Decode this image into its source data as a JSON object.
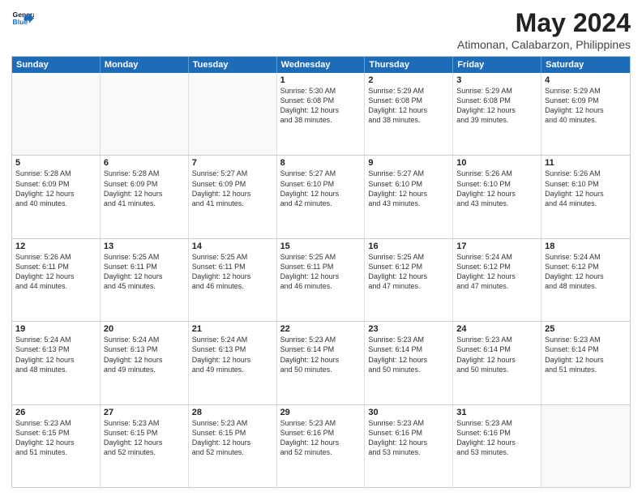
{
  "logo": {
    "line1": "General",
    "line2": "Blue"
  },
  "title": "May 2024",
  "subtitle": "Atimonan, Calabarzon, Philippines",
  "header_days": [
    "Sunday",
    "Monday",
    "Tuesday",
    "Wednesday",
    "Thursday",
    "Friday",
    "Saturday"
  ],
  "weeks": [
    [
      {
        "day": "",
        "info": ""
      },
      {
        "day": "",
        "info": ""
      },
      {
        "day": "",
        "info": ""
      },
      {
        "day": "1",
        "info": "Sunrise: 5:30 AM\nSunset: 6:08 PM\nDaylight: 12 hours\nand 38 minutes."
      },
      {
        "day": "2",
        "info": "Sunrise: 5:29 AM\nSunset: 6:08 PM\nDaylight: 12 hours\nand 38 minutes."
      },
      {
        "day": "3",
        "info": "Sunrise: 5:29 AM\nSunset: 6:08 PM\nDaylight: 12 hours\nand 39 minutes."
      },
      {
        "day": "4",
        "info": "Sunrise: 5:29 AM\nSunset: 6:09 PM\nDaylight: 12 hours\nand 40 minutes."
      }
    ],
    [
      {
        "day": "5",
        "info": "Sunrise: 5:28 AM\nSunset: 6:09 PM\nDaylight: 12 hours\nand 40 minutes."
      },
      {
        "day": "6",
        "info": "Sunrise: 5:28 AM\nSunset: 6:09 PM\nDaylight: 12 hours\nand 41 minutes."
      },
      {
        "day": "7",
        "info": "Sunrise: 5:27 AM\nSunset: 6:09 PM\nDaylight: 12 hours\nand 41 minutes."
      },
      {
        "day": "8",
        "info": "Sunrise: 5:27 AM\nSunset: 6:10 PM\nDaylight: 12 hours\nand 42 minutes."
      },
      {
        "day": "9",
        "info": "Sunrise: 5:27 AM\nSunset: 6:10 PM\nDaylight: 12 hours\nand 43 minutes."
      },
      {
        "day": "10",
        "info": "Sunrise: 5:26 AM\nSunset: 6:10 PM\nDaylight: 12 hours\nand 43 minutes."
      },
      {
        "day": "11",
        "info": "Sunrise: 5:26 AM\nSunset: 6:10 PM\nDaylight: 12 hours\nand 44 minutes."
      }
    ],
    [
      {
        "day": "12",
        "info": "Sunrise: 5:26 AM\nSunset: 6:11 PM\nDaylight: 12 hours\nand 44 minutes."
      },
      {
        "day": "13",
        "info": "Sunrise: 5:25 AM\nSunset: 6:11 PM\nDaylight: 12 hours\nand 45 minutes."
      },
      {
        "day": "14",
        "info": "Sunrise: 5:25 AM\nSunset: 6:11 PM\nDaylight: 12 hours\nand 46 minutes."
      },
      {
        "day": "15",
        "info": "Sunrise: 5:25 AM\nSunset: 6:11 PM\nDaylight: 12 hours\nand 46 minutes."
      },
      {
        "day": "16",
        "info": "Sunrise: 5:25 AM\nSunset: 6:12 PM\nDaylight: 12 hours\nand 47 minutes."
      },
      {
        "day": "17",
        "info": "Sunrise: 5:24 AM\nSunset: 6:12 PM\nDaylight: 12 hours\nand 47 minutes."
      },
      {
        "day": "18",
        "info": "Sunrise: 5:24 AM\nSunset: 6:12 PM\nDaylight: 12 hours\nand 48 minutes."
      }
    ],
    [
      {
        "day": "19",
        "info": "Sunrise: 5:24 AM\nSunset: 6:13 PM\nDaylight: 12 hours\nand 48 minutes."
      },
      {
        "day": "20",
        "info": "Sunrise: 5:24 AM\nSunset: 6:13 PM\nDaylight: 12 hours\nand 49 minutes."
      },
      {
        "day": "21",
        "info": "Sunrise: 5:24 AM\nSunset: 6:13 PM\nDaylight: 12 hours\nand 49 minutes."
      },
      {
        "day": "22",
        "info": "Sunrise: 5:23 AM\nSunset: 6:14 PM\nDaylight: 12 hours\nand 50 minutes."
      },
      {
        "day": "23",
        "info": "Sunrise: 5:23 AM\nSunset: 6:14 PM\nDaylight: 12 hours\nand 50 minutes."
      },
      {
        "day": "24",
        "info": "Sunrise: 5:23 AM\nSunset: 6:14 PM\nDaylight: 12 hours\nand 50 minutes."
      },
      {
        "day": "25",
        "info": "Sunrise: 5:23 AM\nSunset: 6:14 PM\nDaylight: 12 hours\nand 51 minutes."
      }
    ],
    [
      {
        "day": "26",
        "info": "Sunrise: 5:23 AM\nSunset: 6:15 PM\nDaylight: 12 hours\nand 51 minutes."
      },
      {
        "day": "27",
        "info": "Sunrise: 5:23 AM\nSunset: 6:15 PM\nDaylight: 12 hours\nand 52 minutes."
      },
      {
        "day": "28",
        "info": "Sunrise: 5:23 AM\nSunset: 6:15 PM\nDaylight: 12 hours\nand 52 minutes."
      },
      {
        "day": "29",
        "info": "Sunrise: 5:23 AM\nSunset: 6:16 PM\nDaylight: 12 hours\nand 52 minutes."
      },
      {
        "day": "30",
        "info": "Sunrise: 5:23 AM\nSunset: 6:16 PM\nDaylight: 12 hours\nand 53 minutes."
      },
      {
        "day": "31",
        "info": "Sunrise: 5:23 AM\nSunset: 6:16 PM\nDaylight: 12 hours\nand 53 minutes."
      },
      {
        "day": "",
        "info": ""
      }
    ]
  ]
}
